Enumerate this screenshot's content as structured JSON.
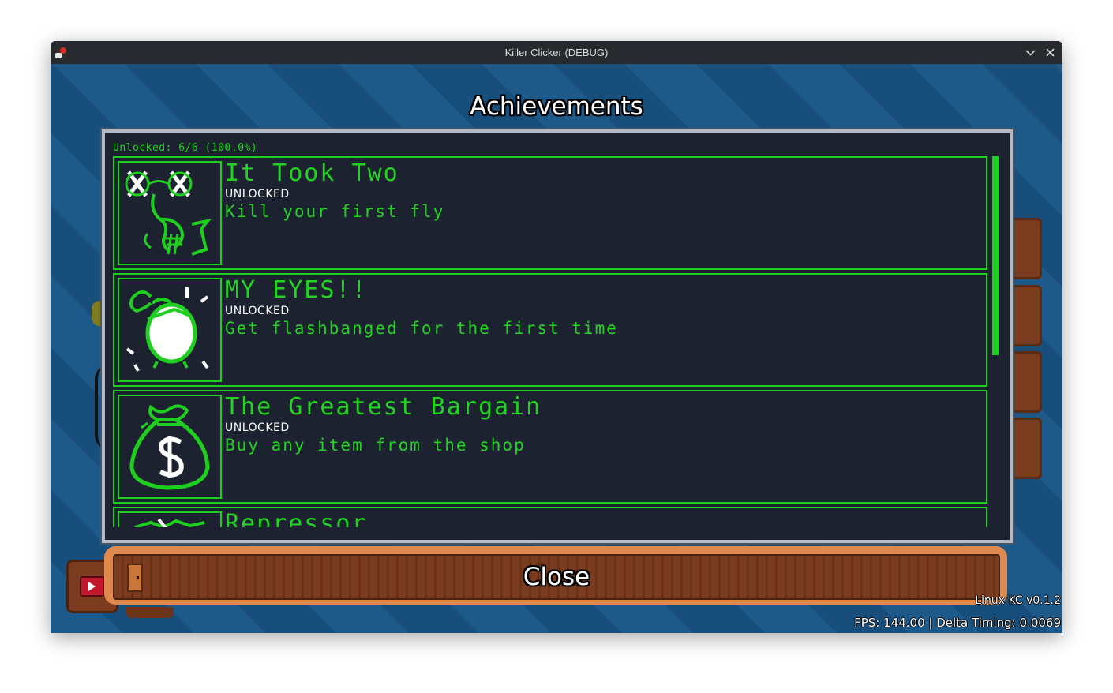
{
  "window": {
    "title": "Killer Clicker (DEBUG)",
    "icons": [
      "app-icon",
      "minimize-chevron-icon",
      "close-icon"
    ]
  },
  "screen": {
    "heading": "Achievements",
    "unlocked_summary": "Unlocked: 6/6 (100.0%)",
    "achievements": [
      {
        "title": "It Took Two",
        "status": "UNLOCKED",
        "description": "Kill your first fly",
        "icon": "dead-fly-icon"
      },
      {
        "title": "MY EYES!!",
        "status": "UNLOCKED",
        "description": "Get flashbanged for the first time",
        "icon": "flashbang-icon"
      },
      {
        "title": "The Greatest Bargain",
        "status": "UNLOCKED",
        "description": "Buy any item from the shop",
        "icon": "money-bag-icon"
      },
      {
        "title": "Repressor",
        "status": "",
        "description": "",
        "icon": "repressor-icon"
      }
    ],
    "close_label": "Close"
  },
  "footer": {
    "version": "Linux KC v0.1.2",
    "fps": "FPS: 144.00 | Delta Timing: 0.0069"
  },
  "colors": {
    "accent_green": "#22d322",
    "panel_bg": "#1c2230",
    "titlebar_bg": "#26292e",
    "background_stripe_a": "#1d5a8a",
    "background_stripe_b": "#184e7b",
    "button_border": "#e0894e"
  }
}
